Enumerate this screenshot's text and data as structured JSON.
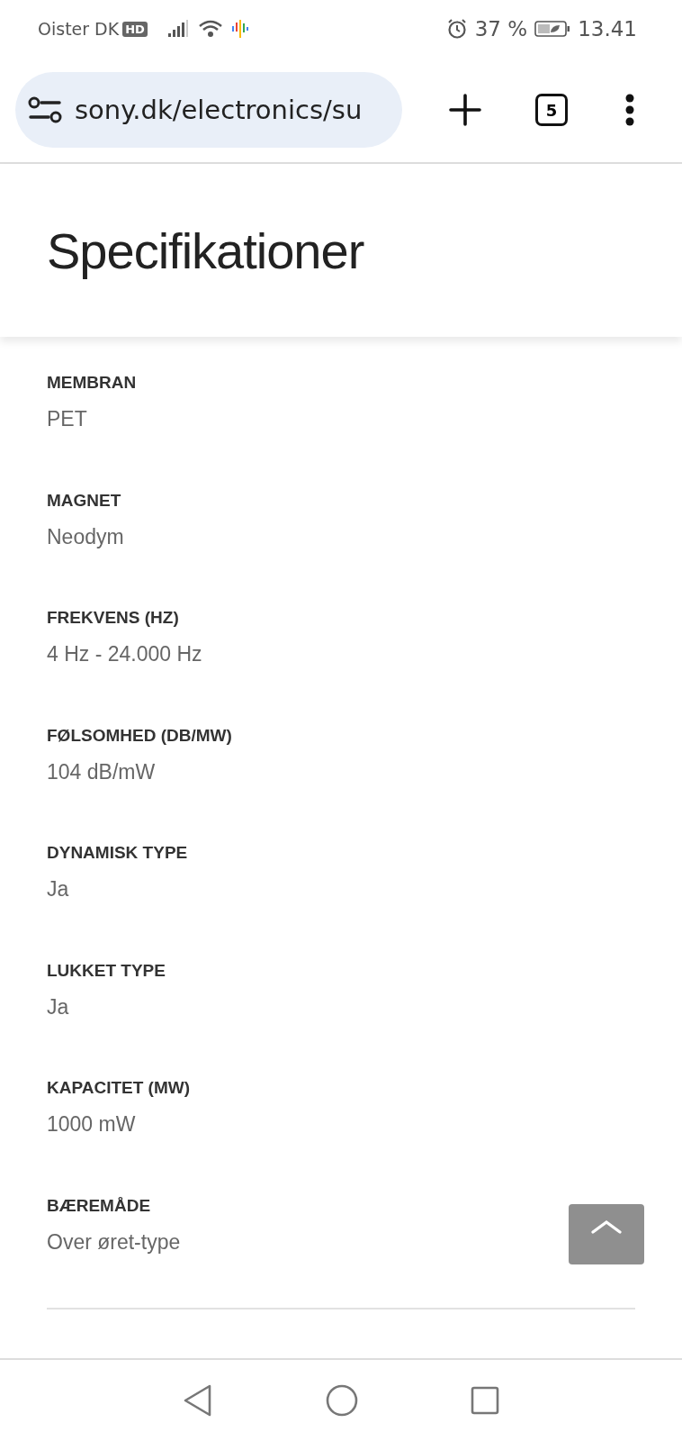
{
  "status_bar": {
    "carrier": "Oister DK",
    "network_badge": "HD",
    "battery": "37 %",
    "time": "13.41"
  },
  "browser": {
    "url": "sony.dk/electronics/su",
    "tab_count": "5"
  },
  "page": {
    "title": "Specifikationer",
    "specs": [
      {
        "label": "MEMBRAN",
        "value": "PET"
      },
      {
        "label": "MAGNET",
        "value": "Neodym"
      },
      {
        "label": "FREKVENS (HZ)",
        "value": "4 Hz - 24.000 Hz"
      },
      {
        "label": "FØLSOMHED (DB/MW)",
        "value": "104 dB/mW"
      },
      {
        "label": "DYNAMISK TYPE",
        "value": "Ja"
      },
      {
        "label": "LUKKET TYPE",
        "value": "Ja"
      },
      {
        "label": "KAPACITET (MW)",
        "value": "1000 mW"
      },
      {
        "label": "BÆREMÅDE",
        "value": "Over øret-type"
      }
    ]
  }
}
